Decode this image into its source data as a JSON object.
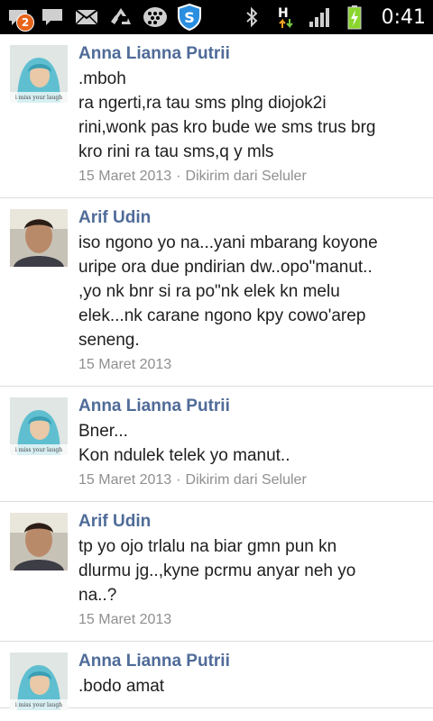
{
  "status_bar": {
    "notification_count": "2",
    "network_label": "H",
    "time": "0:41",
    "left_icons": [
      "chat-notification-icon",
      "message-icon",
      "email-icon",
      "recycle-icon",
      "blackberry-icon",
      "shield-s-icon"
    ],
    "right_icons": [
      "bluetooth-icon",
      "hspa-data-icon",
      "signal-icon",
      "battery-charging-icon"
    ]
  },
  "posts": [
    {
      "author": "Anna Lianna Putrii",
      "avatar": "girl-hijab",
      "lines": [
        ".mboh",
        "ra ngerti,ra tau sms plng diojok2i",
        "rini,wonk pas kro bude we sms trus brg",
        "kro rini ra tau sms,q y mls"
      ],
      "date": "15 Maret 2013",
      "via": "Dikirim dari Seluler"
    },
    {
      "author": "Arif Udin",
      "avatar": "boy",
      "lines": [
        "iso ngono yo na...yani mbarang koyone",
        "uripe ora due pndirian dw..opo\"manut..",
        ",yo nk bnr si ra po\"nk elek kn melu",
        "elek...nk carane ngono kpy cowo'arep",
        "seneng."
      ],
      "date": "15 Maret 2013",
      "via": ""
    },
    {
      "author": "Anna Lianna Putrii",
      "avatar": "girl-hijab",
      "lines": [
        "Bner...",
        "Kon ndulek telek yo manut.."
      ],
      "date": "15 Maret 2013",
      "via": "Dikirim dari Seluler"
    },
    {
      "author": "Arif Udin",
      "avatar": "boy",
      "lines": [
        "tp yo ojo trlalu na biar gmn pun kn",
        "dlurmu jg..,kyne pcrmu anyar neh yo",
        "na..?"
      ],
      "date": "15 Maret 2013",
      "via": ""
    },
    {
      "author": "Anna Lianna Putrii",
      "avatar": "girl-hijab",
      "lines": [
        ".bodo amat"
      ],
      "date": "",
      "via": ""
    }
  ],
  "colors": {
    "author": "#4f6b98",
    "text": "#1e1e1e",
    "meta": "#8f8f8f",
    "divider": "#dcdcdc",
    "status_bar": "#000000",
    "badge": "#e8641b",
    "battery": "#8ad62d",
    "data_arrow_up": "#f0a020",
    "data_arrow_down": "#7ac943"
  }
}
